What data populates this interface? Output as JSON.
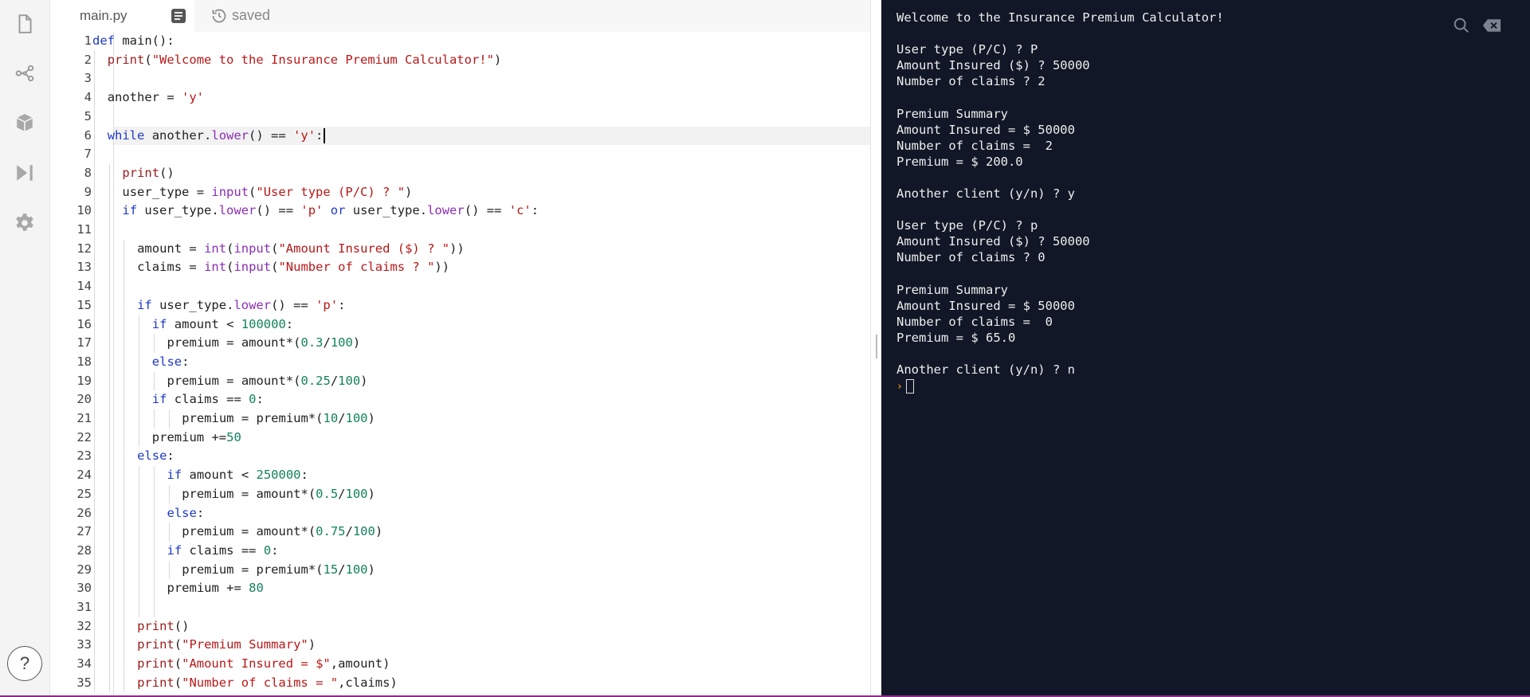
{
  "sidebar": {
    "icons": [
      "file-icon",
      "share-icon",
      "package-icon",
      "run-icon",
      "settings-icon"
    ],
    "help_label": "?"
  },
  "editor": {
    "tab_name": "main.py",
    "save_status": "saved",
    "active_line": 6,
    "code_lines": [
      {
        "n": "1",
        "indent": 0,
        "html": "<span class=\"kw\">def</span> main():"
      },
      {
        "n": "2",
        "indent": 1,
        "html": "<span class=\"fn\">print</span>(<span class=\"str\">\"Welcome to the Insurance Premium Calculator!\"</span>)"
      },
      {
        "n": "3",
        "indent": 1,
        "html": ""
      },
      {
        "n": "4",
        "indent": 1,
        "html": "another = <span class=\"str\">'y'</span>"
      },
      {
        "n": "5",
        "indent": 1,
        "html": ""
      },
      {
        "n": "6",
        "indent": 1,
        "html": "<span class=\"kw\">while</span> another.<span class=\"bi\">lower</span>() == <span class=\"str\">'y'</span>:"
      },
      {
        "n": "7",
        "indent": 1,
        "html": ""
      },
      {
        "n": "8",
        "indent": 2,
        "html": "<span class=\"fn\">print</span>()"
      },
      {
        "n": "9",
        "indent": 2,
        "html": "user_type = <span class=\"bi\">input</span>(<span class=\"str\">\"User type (P/C) ? \"</span>)"
      },
      {
        "n": "10",
        "indent": 2,
        "html": "<span class=\"kw\">if</span> user_type.<span class=\"bi\">lower</span>() == <span class=\"str\">'p'</span> <span class=\"kw\">or</span> user_type.<span class=\"bi\">lower</span>() == <span class=\"str\">'c'</span>:"
      },
      {
        "n": "11",
        "indent": 2,
        "html": ""
      },
      {
        "n": "12",
        "indent": 3,
        "html": "amount = <span class=\"bi\">int</span>(<span class=\"bi\">input</span>(<span class=\"str\">\"Amount Insured ($) ? \"</span>))"
      },
      {
        "n": "13",
        "indent": 3,
        "html": "claims = <span class=\"bi\">int</span>(<span class=\"bi\">input</span>(<span class=\"str\">\"Number of claims ? \"</span>))"
      },
      {
        "n": "14",
        "indent": 3,
        "html": ""
      },
      {
        "n": "15",
        "indent": 3,
        "html": "<span class=\"kw\">if</span> user_type.<span class=\"bi\">lower</span>() == <span class=\"str\">'p'</span>:"
      },
      {
        "n": "16",
        "indent": 4,
        "html": "<span class=\"kw\">if</span> amount &lt; <span class=\"num\">100000</span>:"
      },
      {
        "n": "17",
        "indent": 5,
        "html": "premium = amount*(<span class=\"num\">0.3</span>/<span class=\"num\">100</span>)"
      },
      {
        "n": "18",
        "indent": 4,
        "html": "<span class=\"kw\">else</span>:"
      },
      {
        "n": "19",
        "indent": 5,
        "html": "premium = amount*(<span class=\"num\">0.25</span>/<span class=\"num\">100</span>)"
      },
      {
        "n": "20",
        "indent": 4,
        "html": "<span class=\"kw\">if</span> claims == <span class=\"num\">0</span>:"
      },
      {
        "n": "21",
        "indent": 6,
        "html": "premium = premium*(<span class=\"num\">10</span>/<span class=\"num\">100</span>)"
      },
      {
        "n": "22",
        "indent": 4,
        "html": "premium +=<span class=\"num\">50</span>"
      },
      {
        "n": "23",
        "indent": 3,
        "html": "<span class=\"kw\">else</span>:"
      },
      {
        "n": "24",
        "indent": 5,
        "html": "<span class=\"kw\">if</span> amount &lt; <span class=\"num\">250000</span>:"
      },
      {
        "n": "25",
        "indent": 6,
        "html": "premium = amount*(<span class=\"num\">0.5</span>/<span class=\"num\">100</span>)"
      },
      {
        "n": "26",
        "indent": 5,
        "html": "<span class=\"kw\">else</span>:"
      },
      {
        "n": "27",
        "indent": 6,
        "html": "premium = amount*(<span class=\"num\">0.75</span>/<span class=\"num\">100</span>)"
      },
      {
        "n": "28",
        "indent": 5,
        "html": "<span class=\"kw\">if</span> claims == <span class=\"num\">0</span>:"
      },
      {
        "n": "29",
        "indent": 6,
        "html": "premium = premium*(<span class=\"num\">15</span>/<span class=\"num\">100</span>)"
      },
      {
        "n": "30",
        "indent": 5,
        "html": "premium += <span class=\"num\">80</span>"
      },
      {
        "n": "31",
        "indent": 3,
        "html": ""
      },
      {
        "n": "32",
        "indent": 3,
        "html": "<span class=\"fn\">print</span>()"
      },
      {
        "n": "33",
        "indent": 3,
        "html": "<span class=\"fn\">print</span>(<span class=\"str\">\"Premium Summary\"</span>)"
      },
      {
        "n": "34",
        "indent": 3,
        "html": "<span class=\"fn\">print</span>(<span class=\"str\">\"Amount Insured = $\"</span>,amount)"
      },
      {
        "n": "35",
        "indent": 3,
        "html": "<span class=\"fn\">print</span>(<span class=\"str\">\"Number of claims = \"</span>,claims)"
      }
    ]
  },
  "console": {
    "lines": [
      "Welcome to the Insurance Premium Calculator!",
      "",
      "User type (P/C) ? P",
      "Amount Insured ($) ? 50000",
      "Number of claims ? 2",
      "",
      "Premium Summary",
      "Amount Insured = $ 50000",
      "Number of claims =  2",
      "Premium = $ 200.0",
      "",
      "Another client (y/n) ? y",
      "",
      "User type (P/C) ? p",
      "Amount Insured ($) ? 50000",
      "Number of claims ? 0",
      "",
      "Premium Summary",
      "Amount Insured = $ 50000",
      "Number of claims =  0",
      "Premium = $ 65.0",
      "",
      "Another client (y/n) ? n"
    ],
    "prompt_symbol": "›"
  }
}
